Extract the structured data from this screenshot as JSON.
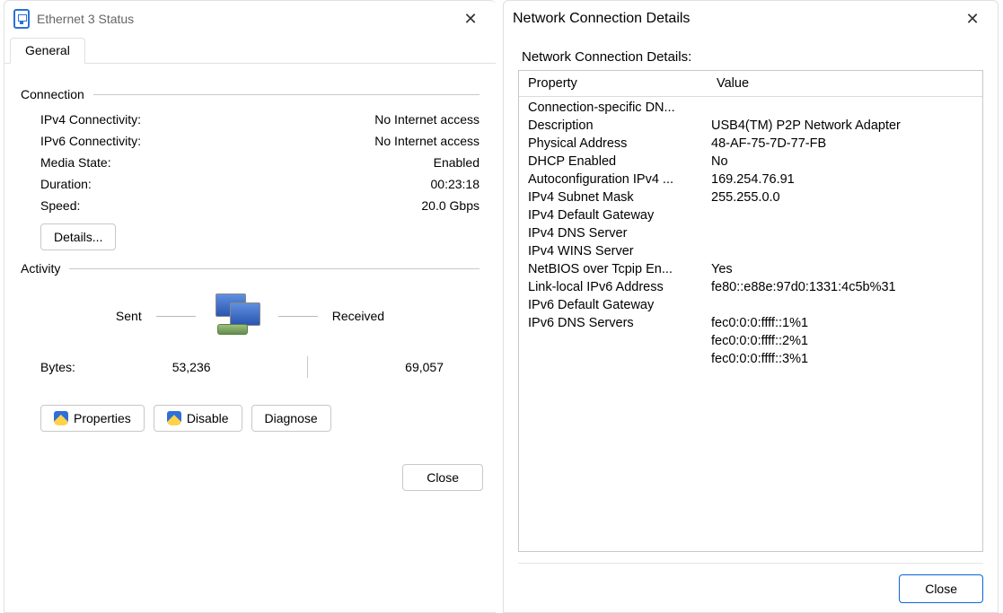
{
  "status": {
    "title": "Ethernet 3 Status",
    "tab_general": "General",
    "group_connection": "Connection",
    "group_activity": "Activity",
    "ipv4_label": "IPv4 Connectivity:",
    "ipv4_value": "No Internet access",
    "ipv6_label": "IPv6 Connectivity:",
    "ipv6_value": "No Internet access",
    "media_label": "Media State:",
    "media_value": "Enabled",
    "duration_label": "Duration:",
    "duration_value": "00:23:18",
    "speed_label": "Speed:",
    "speed_value": "20.0 Gbps",
    "details_btn": "Details...",
    "sent_label": "Sent",
    "received_label": "Received",
    "bytes_label": "Bytes:",
    "bytes_sent": "53,236",
    "bytes_received": "69,057",
    "properties_btn": "Properties",
    "disable_btn": "Disable",
    "diagnose_btn": "Diagnose",
    "close_btn": "Close"
  },
  "details": {
    "title": "Network Connection Details",
    "subtitle": "Network Connection Details:",
    "col_property": "Property",
    "col_value": "Value",
    "close_btn": "Close",
    "rows": [
      {
        "p": "Connection-specific DN...",
        "v": ""
      },
      {
        "p": "Description",
        "v": "USB4(TM) P2P Network Adapter"
      },
      {
        "p": "Physical Address",
        "v": "48-AF-75-7D-77-FB"
      },
      {
        "p": "DHCP Enabled",
        "v": "No"
      },
      {
        "p": "Autoconfiguration IPv4 ...",
        "v": "169.254.76.91"
      },
      {
        "p": "IPv4 Subnet Mask",
        "v": "255.255.0.0"
      },
      {
        "p": "IPv4 Default Gateway",
        "v": ""
      },
      {
        "p": "IPv4 DNS Server",
        "v": ""
      },
      {
        "p": "IPv4 WINS Server",
        "v": ""
      },
      {
        "p": "NetBIOS over Tcpip En...",
        "v": "Yes"
      },
      {
        "p": "Link-local IPv6 Address",
        "v": "fe80::e88e:97d0:1331:4c5b%31"
      },
      {
        "p": "IPv6 Default Gateway",
        "v": ""
      },
      {
        "p": "IPv6 DNS Servers",
        "v": "fec0:0:0:ffff::1%1"
      },
      {
        "p": "",
        "v": "fec0:0:0:ffff::2%1"
      },
      {
        "p": "",
        "v": "fec0:0:0:ffff::3%1"
      }
    ]
  }
}
